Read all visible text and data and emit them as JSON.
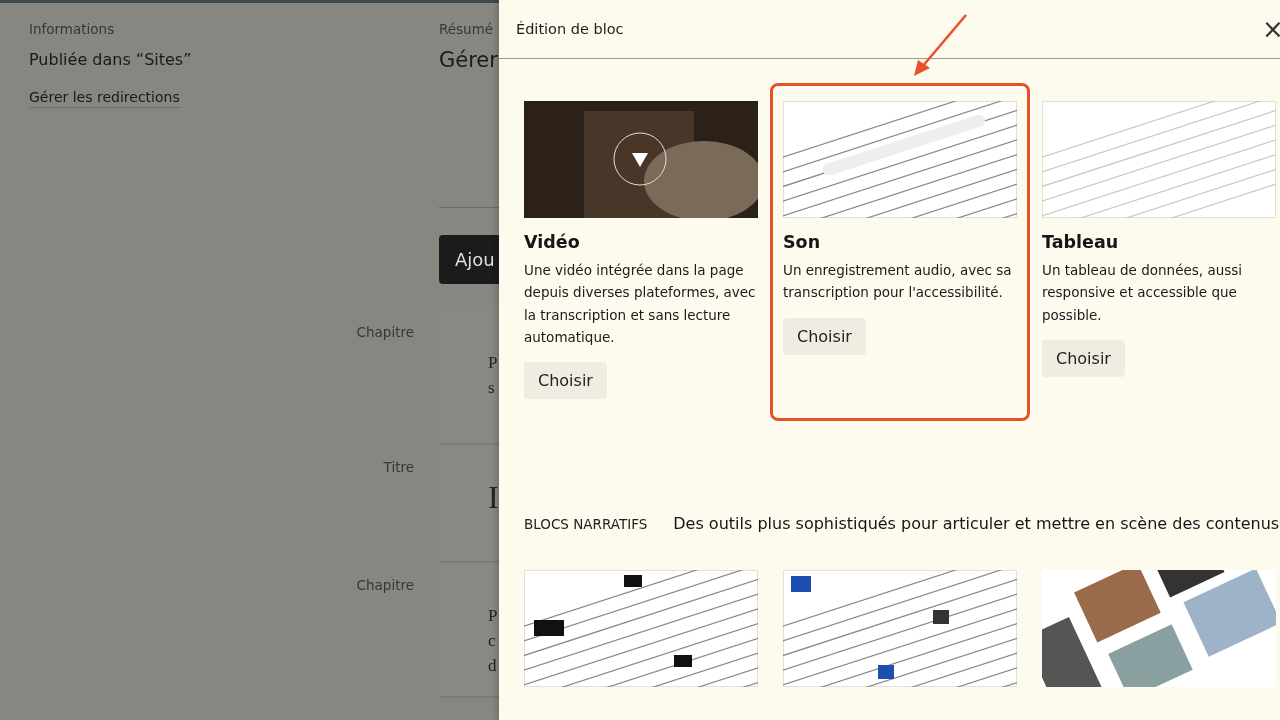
{
  "page": {
    "info_label": "Informations",
    "published": "Publiée dans “Sites”",
    "redirect_link": "Gérer les redirections",
    "summary_label": "Résumé",
    "summary_value": "Gérer",
    "add_button": "Ajou",
    "blocks": [
      {
        "label": "Chapitre",
        "lines": [
          "P",
          "s"
        ],
        "kind": "paragraph"
      },
      {
        "label": "Titre",
        "lines": [
          "I"
        ],
        "kind": "heading"
      },
      {
        "label": "Chapitre",
        "lines": [
          "P",
          "c",
          "d"
        ],
        "kind": "paragraph"
      }
    ]
  },
  "modal": {
    "title": "Édition de bloc",
    "close": "×",
    "blocks": [
      {
        "kind": "video",
        "title": "Vidéo",
        "description": "Une vidéo intégrée dans la page depuis diverses plateformes, avec la transcription et sans lecture automatique.",
        "button": "Choisir",
        "highlighted": false
      },
      {
        "kind": "document",
        "title": "Son",
        "description": "Un enregistrement audio, avec sa transcription pour l'accessibilité.",
        "button": "Choisir",
        "highlighted": true
      },
      {
        "kind": "table",
        "title": "Tableau",
        "description": "Un tableau de données, aussi responsive et accessible que possible.",
        "button": "Choisir",
        "highlighted": false
      }
    ],
    "section": {
      "label": "BLOCS NARRATIFS",
      "description": "Des outils plus sophistiqués pour articuler et mettre en scène des contenus"
    },
    "narrative_previews": [
      {
        "kind": "stats"
      },
      {
        "kind": "article"
      },
      {
        "kind": "gallery"
      }
    ]
  }
}
